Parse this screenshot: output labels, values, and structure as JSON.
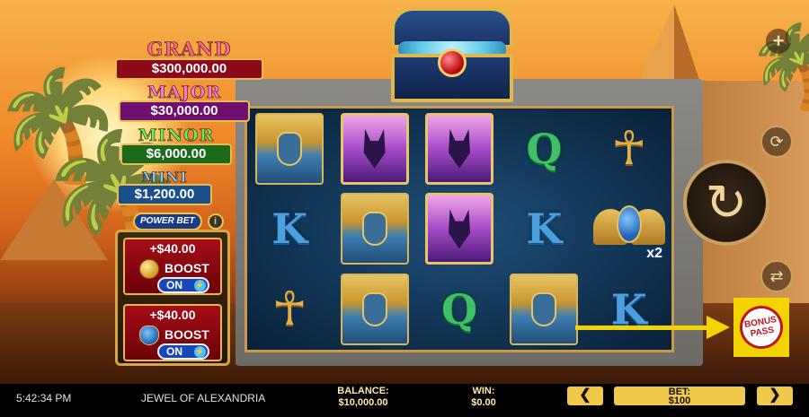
{
  "game_title": "JEWEL OF ALEXANDRIA",
  "jackpots": {
    "grand": {
      "label": "GRAND",
      "value": "$300,000.00"
    },
    "major": {
      "label": "MAJOR",
      "value": "$30,000.00"
    },
    "minor": {
      "label": "MINOR",
      "value": "$6,000.00"
    },
    "mini": {
      "label": "MINI",
      "value": "$1,200.00"
    }
  },
  "power_bet": {
    "logo": "POWER BET",
    "info_icon": "i",
    "boosts": [
      {
        "amount": "+$40.00",
        "label": "BOOST",
        "toggle": "ON",
        "icon": "gold-coin-icon"
      },
      {
        "amount": "+$40.00",
        "label": "BOOST",
        "toggle": "ON",
        "icon": "scarab-icon"
      }
    ]
  },
  "reels": [
    [
      "pharaoh",
      "anubis",
      "anubis",
      "Q",
      "ankh"
    ],
    [
      "K",
      "pharaoh",
      "anubis",
      "K",
      "scarab"
    ],
    [
      "ankh",
      "pharaoh",
      "Q",
      "pharaoh",
      "K"
    ]
  ],
  "scarab_multiplier": "x2",
  "controls": {
    "plus": "+",
    "bonus_pass_line1": "BONUS",
    "bonus_pass_line2": "PASS"
  },
  "bottom": {
    "time": "5:42:34 PM",
    "balance_label": "BALANCE:",
    "balance_value": "$10,000.00",
    "win_label": "WIN:",
    "win_value": "$0.00",
    "bet_label": "BET:",
    "bet_value": "$100",
    "prev": "❮",
    "next": "❯"
  },
  "colors": {
    "accent_gold": "#e6bb57",
    "bonus_pass_yellow": "#f3d400",
    "grand_red": "#8c0a1a",
    "major_purple": "#6e0f6e",
    "minor_green": "#1d6a1a",
    "mini_blue": "#1a4f8c"
  }
}
